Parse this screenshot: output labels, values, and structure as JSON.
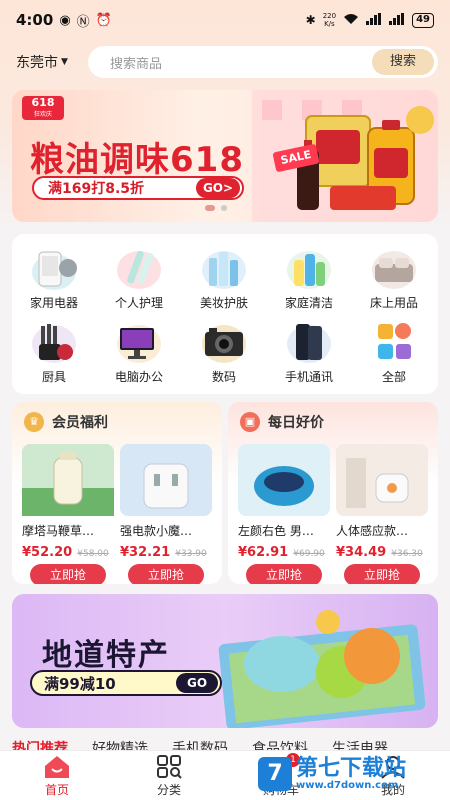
{
  "status_bar": {
    "time": "4:00",
    "net_speed_value": "220",
    "net_speed_unit": "K/s",
    "battery": "49"
  },
  "header": {
    "city": "东莞市",
    "search_placeholder": "搜索商品",
    "search_button": "搜索"
  },
  "banner_top": {
    "tag": "618",
    "tag_sub": "狂欢庆",
    "title": "粮油调味618",
    "promo": "满169打8.5折",
    "go": "GO>",
    "sale_badge": "SALE"
  },
  "categories": [
    {
      "label": "家用电器",
      "icon": "air-cooler-icon"
    },
    {
      "label": "个人护理",
      "icon": "personal-care-icon"
    },
    {
      "label": "美妆护肤",
      "icon": "skincare-bottles-icon"
    },
    {
      "label": "家庭清洁",
      "icon": "cleaning-bottles-icon"
    },
    {
      "label": "床上用品",
      "icon": "bedding-icon"
    },
    {
      "label": "厨具",
      "icon": "knife-set-icon"
    },
    {
      "label": "电脑办公",
      "icon": "computer-icon"
    },
    {
      "label": "数码",
      "icon": "camera-icon"
    },
    {
      "label": "手机通讯",
      "icon": "phone-icon"
    },
    {
      "label": "全部",
      "icon": "all-grid-icon"
    }
  ],
  "member_card": {
    "title": "会员福利",
    "products": [
      {
        "name": "摩塔马鞭草…",
        "price": "¥52.20",
        "was": "¥58.00",
        "buy": "立即抢"
      },
      {
        "name": "强电款小魔…",
        "price": "¥32.21",
        "was": "¥33.90",
        "buy": "立即抢"
      }
    ]
  },
  "daily_card": {
    "title": "每日好价",
    "products": [
      {
        "name": "左颜右色 男…",
        "price": "¥62.91",
        "was": "¥69.90",
        "buy": "立即抢"
      },
      {
        "name": "人体感应款…",
        "price": "¥34.49",
        "was": "¥36.30",
        "buy": "立即抢"
      }
    ]
  },
  "banner_bottom": {
    "title": "地道特产",
    "promo": "满99减10",
    "go": "GO"
  },
  "tab_strip": [
    "热门推荐",
    "好物精选",
    "手机数码",
    "食品饮料",
    "生活电器"
  ],
  "bottom_nav": [
    {
      "label": "首页",
      "icon": "home-icon"
    },
    {
      "label": "分类",
      "icon": "category-search-icon"
    },
    {
      "label": "购物车",
      "icon": "cart-icon",
      "badge": "1"
    },
    {
      "label": "我的",
      "icon": "profile-icon"
    }
  ],
  "watermark": {
    "logo": "7",
    "text": "第七下载站",
    "url": "www.d7down.com"
  },
  "colors": {
    "accent": "#e0212e",
    "gold": "#f4ddb8",
    "purple_banner": "#dcb8f5"
  }
}
